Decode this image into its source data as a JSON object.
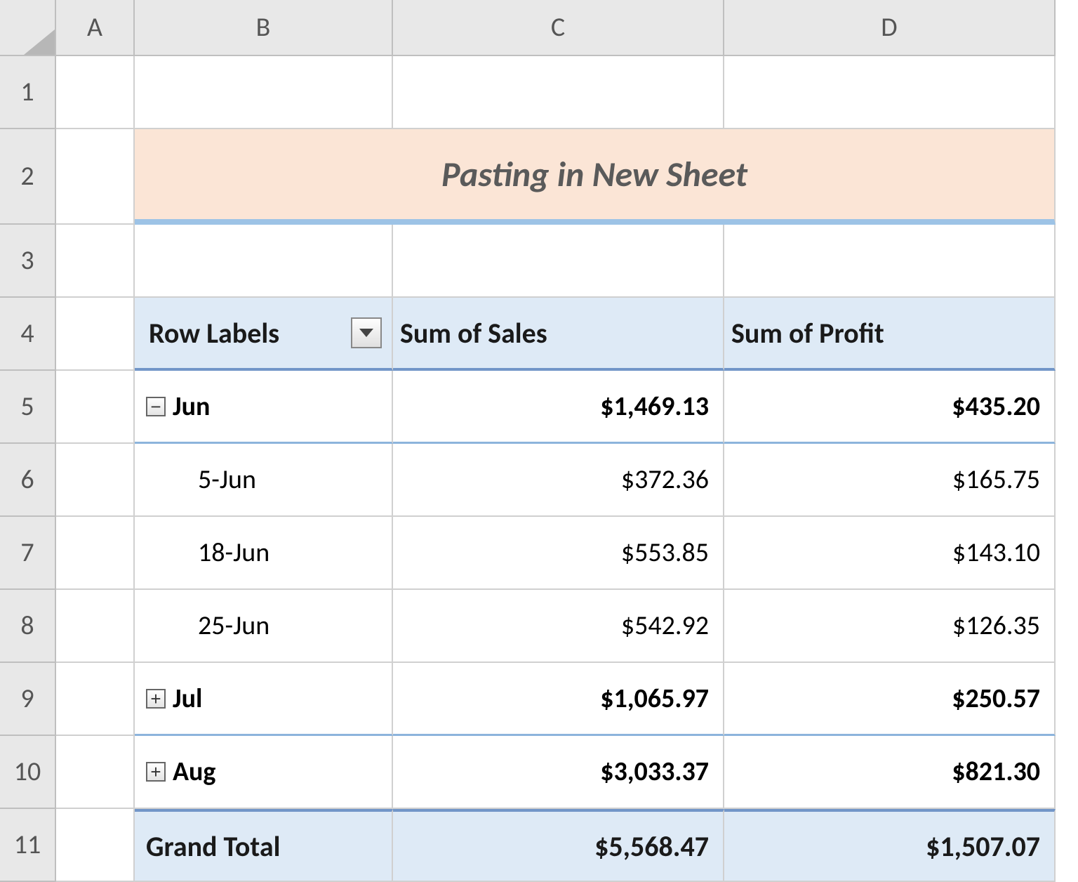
{
  "columns": [
    "A",
    "B",
    "C",
    "D"
  ],
  "rows": [
    "1",
    "2",
    "3",
    "4",
    "5",
    "6",
    "7",
    "8",
    "9",
    "10",
    "11"
  ],
  "title": "Pasting in New Sheet",
  "pivot": {
    "headers": {
      "row_labels": "Row Labels",
      "sum_sales": "Sum of Sales",
      "sum_profit": "Sum of Profit"
    },
    "groups": [
      {
        "label": "Jun",
        "expanded": true,
        "sales": "$1,469.13",
        "profit": "$435.20",
        "children": [
          {
            "label": "5-Jun",
            "sales": "$372.36",
            "profit": "$165.75"
          },
          {
            "label": "18-Jun",
            "sales": "$553.85",
            "profit": "$143.10"
          },
          {
            "label": "25-Jun",
            "sales": "$542.92",
            "profit": "$126.35"
          }
        ]
      },
      {
        "label": "Jul",
        "expanded": false,
        "sales": "$1,065.97",
        "profit": "$250.57"
      },
      {
        "label": "Aug",
        "expanded": false,
        "sales": "$3,033.37",
        "profit": "$821.30"
      }
    ],
    "grand_total": {
      "label": "Grand Total",
      "sales": "$5,568.47",
      "profit": "$1,507.07"
    }
  },
  "icons": {
    "collapse": "−",
    "expand": "+"
  }
}
